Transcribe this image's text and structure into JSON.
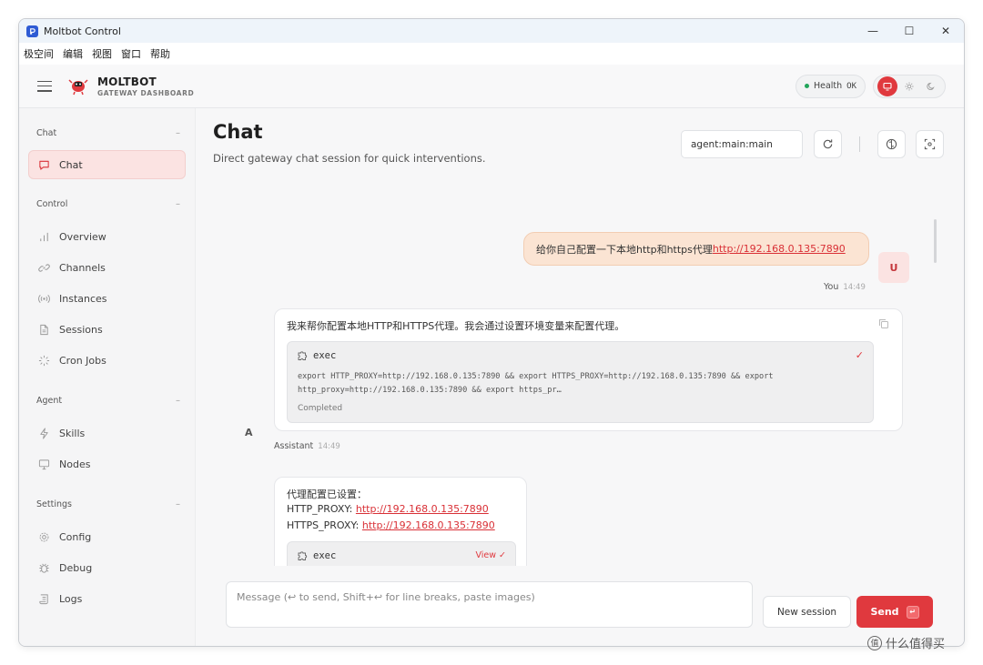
{
  "window": {
    "title": "Moltbot Control"
  },
  "menu": [
    "极空间",
    "编辑",
    "视图",
    "窗口",
    "帮助"
  ],
  "brand": {
    "name": "MOLTBOT",
    "subtitle": "GATEWAY DASHBOARD"
  },
  "health": {
    "label": "Health",
    "value": "OK"
  },
  "sidebar": {
    "sections": [
      {
        "title": "Chat",
        "items": [
          {
            "label": "Chat",
            "icon": "message-icon",
            "active": true
          }
        ]
      },
      {
        "title": "Control",
        "items": [
          {
            "label": "Overview",
            "icon": "bar-chart-icon"
          },
          {
            "label": "Channels",
            "icon": "link-icon"
          },
          {
            "label": "Instances",
            "icon": "radio-icon"
          },
          {
            "label": "Sessions",
            "icon": "file-icon"
          },
          {
            "label": "Cron Jobs",
            "icon": "loader-icon"
          }
        ]
      },
      {
        "title": "Agent",
        "items": [
          {
            "label": "Skills",
            "icon": "zap-icon"
          },
          {
            "label": "Nodes",
            "icon": "monitor-icon"
          }
        ]
      },
      {
        "title": "Settings",
        "items": [
          {
            "label": "Config",
            "icon": "gear-icon"
          },
          {
            "label": "Debug",
            "icon": "bug-icon"
          },
          {
            "label": "Logs",
            "icon": "scroll-icon"
          }
        ]
      }
    ]
  },
  "page": {
    "title": "Chat",
    "subtitle": "Direct gateway chat session for quick interventions.",
    "session_key": "agent:main:main"
  },
  "messages": {
    "user": {
      "text": "给你自己配置一下本地http和https代理 ",
      "link": "http://192.168.0.135:7890",
      "author": "You",
      "time": "14:49",
      "avatar": "U"
    },
    "assistant1": {
      "text": "我来帮你配置本地HTTP和HTTPS代理。我会通过设置环境变量来配置代理。",
      "tool": {
        "name": "exec",
        "code": "export HTTP_PROXY=http://192.168.0.135:7890 && export HTTPS_PROXY=http://192.168.0.135:7890 && export\nhttp_proxy=http://192.168.0.135:7890 && export https_pr…",
        "status": "Completed"
      },
      "author": "Assistant",
      "time": "14:49",
      "avatar": "A"
    },
    "assistant2": {
      "heading": "代理配置已设置：",
      "http_label": "HTTP_PROXY: ",
      "http_link": "http://192.168.0.135:7890",
      "https_label": "HTTPS_PROXY: ",
      "https_link": "http://192.168.0.135:7890",
      "tool": {
        "name": "exec",
        "view": "View ✓"
      }
    }
  },
  "composer": {
    "placeholder": "Message (↩ to send, Shift+↩ for line breaks, paste images)",
    "new_session": "New session",
    "send": "Send",
    "send_key": "↵"
  },
  "watermark": {
    "symbol": "值",
    "text": "什么值得买"
  },
  "colors": {
    "accent": "#e0393e",
    "user_bubble": "#fbe4d3",
    "active_nav": "#fbe3e2",
    "health_dot": "#22a55a"
  }
}
